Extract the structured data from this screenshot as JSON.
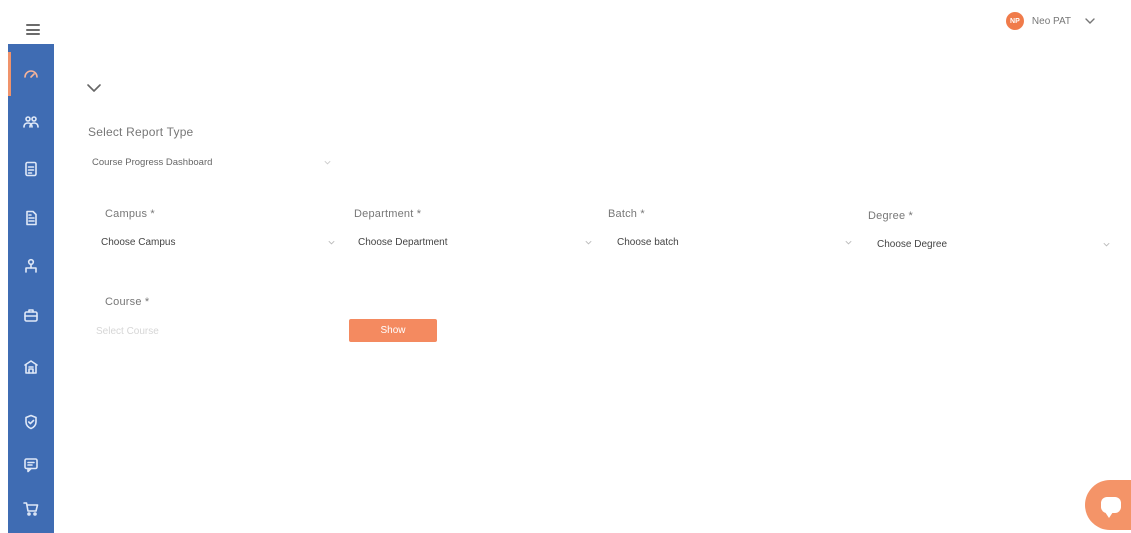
{
  "user": {
    "initials": "NP",
    "name": "Neo PAT"
  },
  "sidebar": {
    "items": [
      {
        "icon": "dashboard-icon"
      },
      {
        "icon": "users-icon"
      },
      {
        "icon": "document-icon"
      },
      {
        "icon": "report-icon"
      },
      {
        "icon": "org-icon"
      },
      {
        "icon": "briefcase-icon"
      },
      {
        "icon": "building-icon"
      },
      {
        "icon": "shield-icon"
      },
      {
        "icon": "chat-icon"
      },
      {
        "icon": "cart-icon"
      }
    ]
  },
  "report": {
    "type_label": "Select Report Type",
    "type_value": "Course Progress Dashboard"
  },
  "filters": {
    "campus": {
      "label": "Campus *",
      "value": "Choose Campus"
    },
    "department": {
      "label": "Department *",
      "value": "Choose Department"
    },
    "batch": {
      "label": "Batch *",
      "value": "Choose batch"
    },
    "degree": {
      "label": "Degree *",
      "value": "Choose Degree"
    },
    "course": {
      "label": "Course *",
      "placeholder": "Select Course"
    }
  },
  "actions": {
    "show_label": "Show"
  },
  "colors": {
    "sidebar": "#3f6cb3",
    "accent": "#f48a60"
  }
}
